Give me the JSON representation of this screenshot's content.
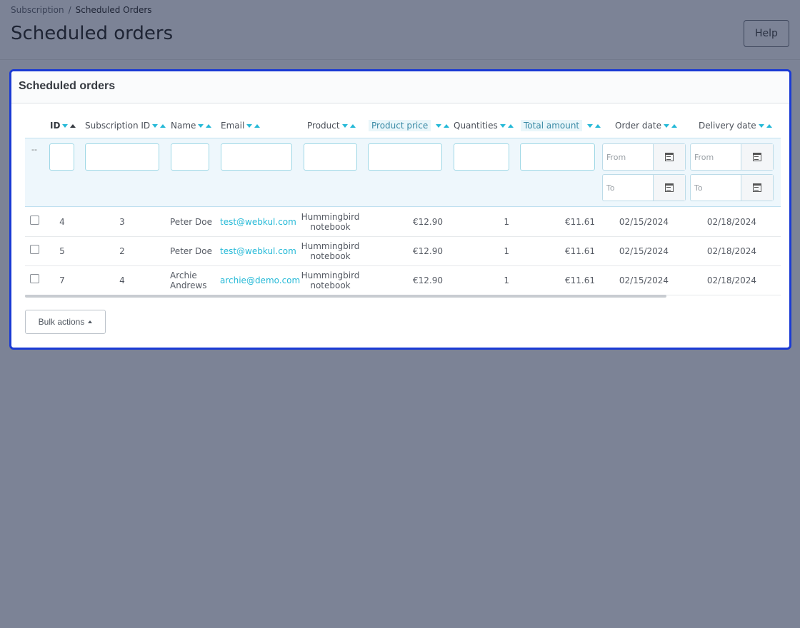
{
  "breadcrumb": {
    "parent": "Subscription",
    "separator": "/",
    "current": "Scheduled Orders"
  },
  "page": {
    "title": "Scheduled orders",
    "help_label": "Help"
  },
  "card": {
    "title": "Scheduled orders"
  },
  "columns": [
    {
      "key": "id",
      "label": "ID"
    },
    {
      "key": "subscription_id",
      "label": "Subscription ID"
    },
    {
      "key": "name",
      "label": "Name"
    },
    {
      "key": "email",
      "label": "Email"
    },
    {
      "key": "product",
      "label": "Product"
    },
    {
      "key": "product_price",
      "label": "Product price"
    },
    {
      "key": "quantities",
      "label": "Quantities"
    },
    {
      "key": "total_amount",
      "label": "Total amount"
    },
    {
      "key": "order_date",
      "label": "Order date"
    },
    {
      "key": "delivery_date",
      "label": "Delivery date"
    }
  ],
  "filters": {
    "row_marker": "--",
    "from_placeholder": "From",
    "to_placeholder": "To"
  },
  "rows": [
    {
      "id": "4",
      "subscription_id": "3",
      "name_line1": "Peter Doe",
      "name_line2": "",
      "email": "test@webkul.com",
      "product_line1": "Hummingbird",
      "product_line2": "notebook",
      "product_price": "€12.90",
      "quantities": "1",
      "total_amount": "€11.61",
      "order_date": "02/15/2024",
      "delivery_date": "02/18/2024"
    },
    {
      "id": "5",
      "subscription_id": "2",
      "name_line1": "Peter Doe",
      "name_line2": "",
      "email": "test@webkul.com",
      "product_line1": "Hummingbird",
      "product_line2": "notebook",
      "product_price": "€12.90",
      "quantities": "1",
      "total_amount": "€11.61",
      "order_date": "02/15/2024",
      "delivery_date": "02/18/2024"
    },
    {
      "id": "7",
      "subscription_id": "4",
      "name_line1": "Archie",
      "name_line2": "Andrews",
      "email": "archie@demo.com",
      "product_line1": "Hummingbird",
      "product_line2": "notebook",
      "product_price": "€12.90",
      "quantities": "1",
      "total_amount": "€11.61",
      "order_date": "02/15/2024",
      "delivery_date": "02/18/2024"
    }
  ],
  "bulk_actions": {
    "label": "Bulk actions"
  },
  "colors": {
    "accent": "#25b9d7",
    "focus_border": "#1a3ad4",
    "backdrop": "#7c8396"
  }
}
